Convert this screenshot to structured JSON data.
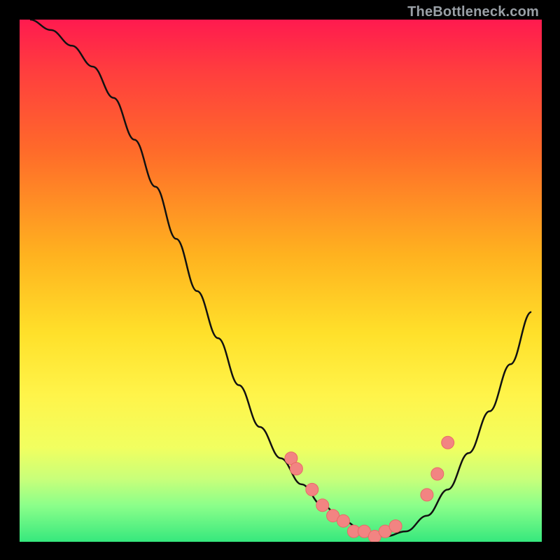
{
  "attribution": "TheBottleneck.com",
  "chart_data": {
    "type": "line",
    "title": "",
    "xlabel": "",
    "ylabel": "",
    "xlim": [
      0,
      100
    ],
    "ylim": [
      0,
      100
    ],
    "series": [
      {
        "name": "curve",
        "x": [
          2,
          6,
          10,
          14,
          18,
          22,
          26,
          30,
          34,
          38,
          42,
          46,
          50,
          54,
          58,
          62,
          66,
          70,
          74,
          78,
          82,
          86,
          90,
          94,
          98
        ],
        "values": [
          100,
          98,
          95,
          91,
          85,
          77,
          68,
          58,
          48,
          39,
          30,
          22,
          16,
          11,
          7,
          4,
          2,
          1,
          2,
          5,
          10,
          17,
          25,
          34,
          44
        ]
      },
      {
        "name": "dots",
        "x": [
          52,
          53,
          56,
          58,
          60,
          62,
          64,
          66,
          68,
          70,
          72,
          78,
          80,
          82
        ],
        "values": [
          16,
          14,
          10,
          7,
          5,
          4,
          2,
          2,
          1,
          2,
          3,
          9,
          13,
          19
        ]
      }
    ]
  }
}
